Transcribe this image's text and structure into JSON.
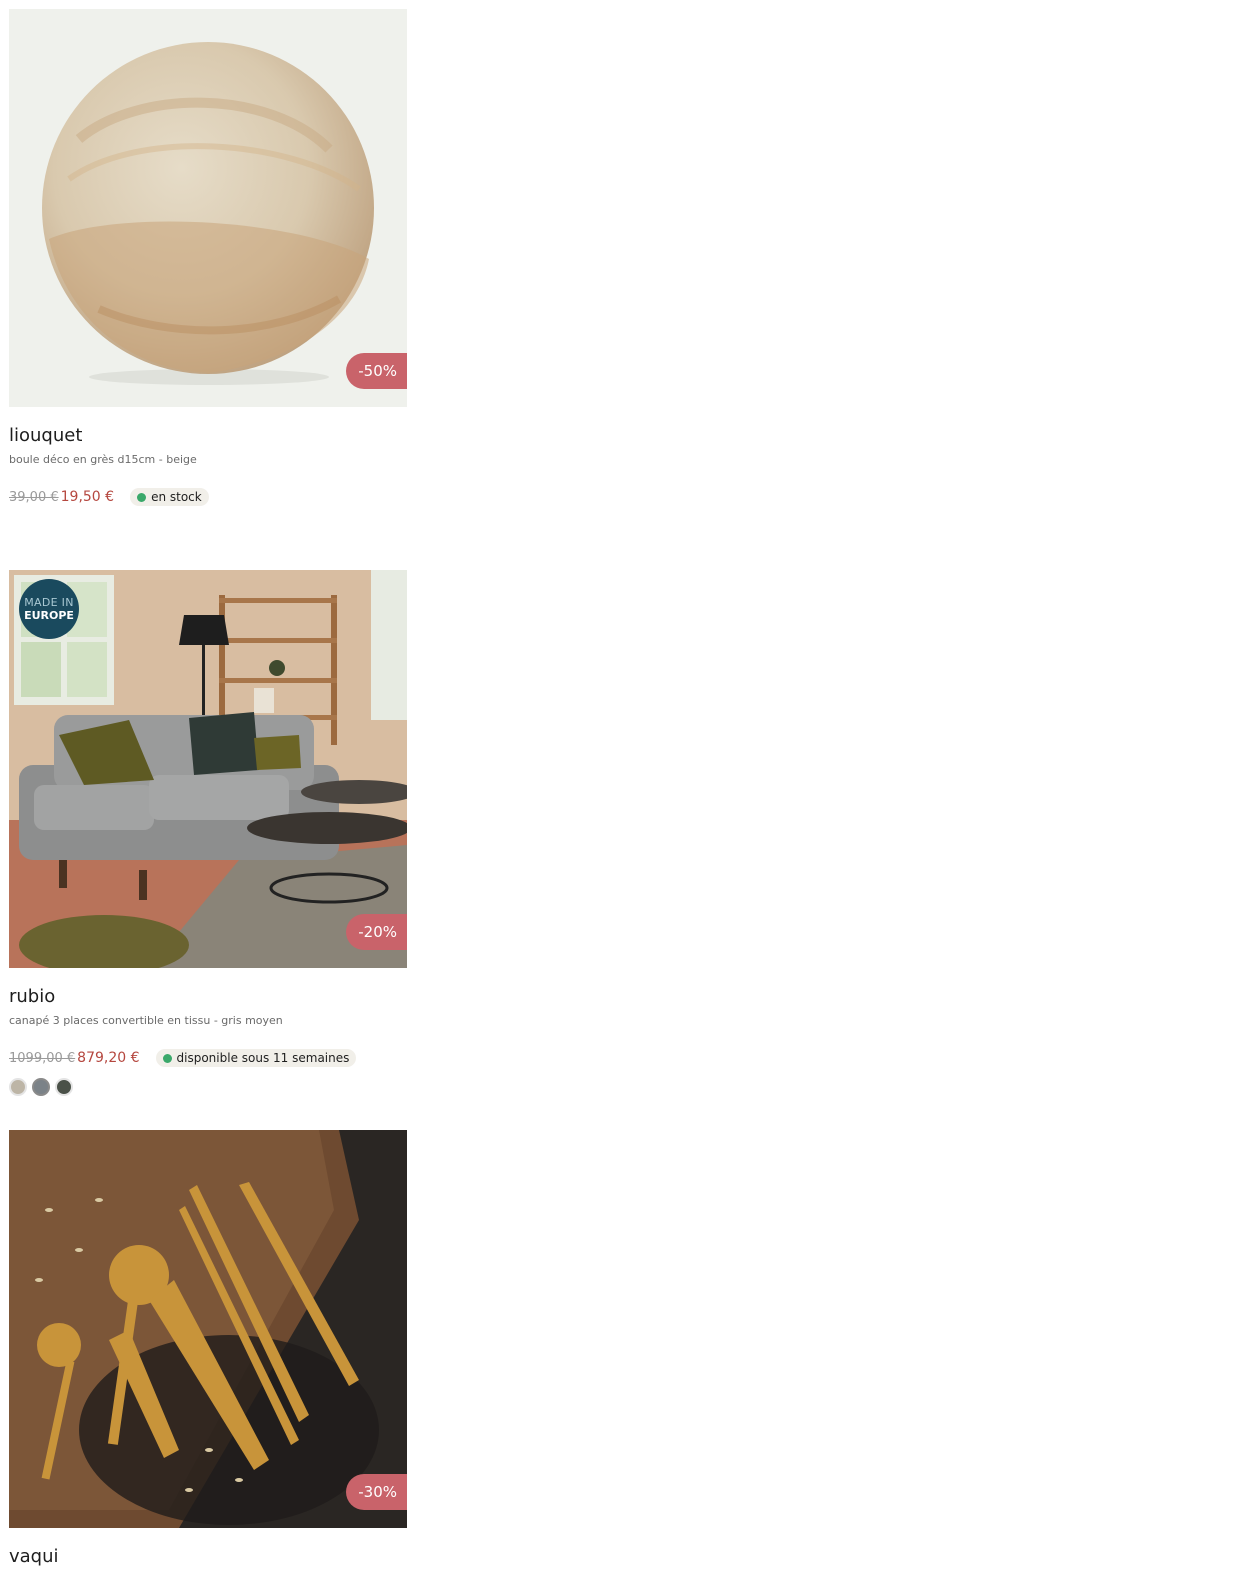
{
  "theme": {
    "discount_bg": "#c9636a",
    "price_red": "#b5473f",
    "stock_green": "#3aa86a",
    "europe_badge_bg": "#1a4a5e"
  },
  "products": [
    {
      "image_alt": "boule déco en grès",
      "discount": "-50%",
      "name": "liouquet",
      "description": "boule déco en grès d15cm - beige",
      "old_price": "39,00 €",
      "price": "19,50 €",
      "stock": "en stock"
    },
    {
      "image_alt": "canapé rubio dans un salon",
      "badge": {
        "line1": "MADE IN",
        "line2": "EUROPE"
      },
      "discount": "-20%",
      "name": "rubio",
      "description": "canapé 3 places convertible en tissu - gris moyen",
      "old_price": "1099,00 €",
      "price": "879,20 €",
      "stock": "disponible sous 11 semaines",
      "swatches": [
        {
          "color": "#bdb5a6",
          "selected": false
        },
        {
          "color": "#7b8288",
          "selected": true
        },
        {
          "color": "#4a5148",
          "selected": false
        }
      ]
    },
    {
      "image_alt": "couverts dorés",
      "discount": "-30%",
      "name": "vaqui"
    }
  ]
}
